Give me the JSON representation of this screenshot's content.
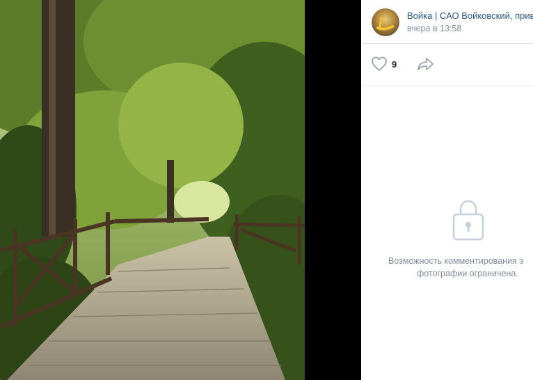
{
  "post": {
    "author": "Войка | САО Войковский, прив",
    "date": "вчера в 13:58",
    "likes": "9",
    "icons": {
      "like": "heart-icon",
      "share": "share-arrow-icon",
      "lock": "lock-icon"
    }
  },
  "comments": {
    "restricted_line1": "Возможность комментирования э",
    "restricted_line2": "фотографии ограничена."
  },
  "colors": {
    "link": "#2a5885",
    "muted": "#818c99",
    "icon": "#99a2ad",
    "background": "#000000"
  }
}
